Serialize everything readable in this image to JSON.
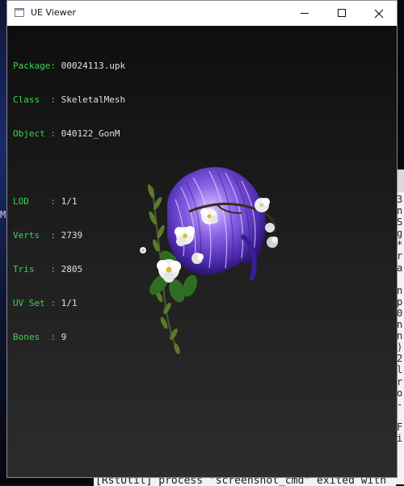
{
  "window": {
    "title": "UE Viewer"
  },
  "info": {
    "package_label": "Package: ",
    "package_value": "00024113.upk",
    "class_label": "Class  : ",
    "class_value": "SkeletalMesh",
    "object_label": "Object : ",
    "object_value": "040122_GonM",
    "lod_label": "LOD    : ",
    "lod_value": "1/1",
    "verts_label": "Verts  : ",
    "verts_value": "2739",
    "tris_label": "Tris   : ",
    "tris_value": "2805",
    "uvset_label": "UV Set : ",
    "uvset_value": "1/1",
    "bones_label": "Bones  : ",
    "bones_value": "9"
  },
  "background": {
    "right_chars": "3\nn\nS\ng\n*\nr\na\n\nn\np\n0\nn\nn\n)\n2\nl\nr\no\n-\n\nF\ni",
    "left_char": "M",
    "bottom_text": "[RstUtil] process \"screenshot_cmd\" exited with"
  }
}
